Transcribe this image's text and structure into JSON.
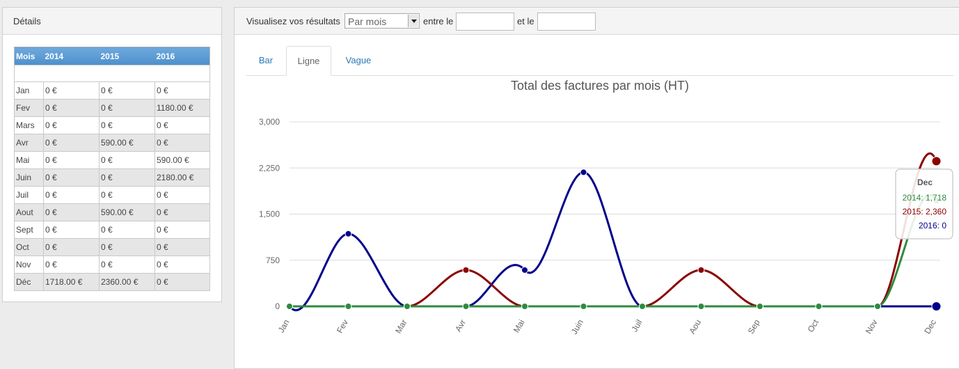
{
  "details": {
    "title": "Détails",
    "headers": [
      "Mois",
      "2014",
      "2015",
      "2016"
    ],
    "rows": [
      [
        "Jan",
        "0 €",
        "0 €",
        "0 €"
      ],
      [
        "Fev",
        "0 €",
        "0 €",
        "1180.00 €"
      ],
      [
        "Mars",
        "0 €",
        "0 €",
        "0 €"
      ],
      [
        "Avr",
        "0 €",
        "590.00 €",
        "0 €"
      ],
      [
        "Mai",
        "0 €",
        "0 €",
        "590.00 €"
      ],
      [
        "Juin",
        "0 €",
        "0 €",
        "2180.00 €"
      ],
      [
        "Juil",
        "0 €",
        "0 €",
        "0 €"
      ],
      [
        "Aout",
        "0 €",
        "590.00 €",
        "0 €"
      ],
      [
        "Sept",
        "0 €",
        "0 €",
        "0 €"
      ],
      [
        "Oct",
        "0 €",
        "0 €",
        "0 €"
      ],
      [
        "Nov",
        "0 €",
        "0 €",
        "0 €"
      ],
      [
        "Déc",
        "1718.00 €",
        "2360.00 €",
        "0 €"
      ]
    ]
  },
  "filter": {
    "label": "Visualisez vos résultats",
    "period_value": "Par mois",
    "between_label": "entre le",
    "and_label": "et le",
    "date_from": "",
    "date_to": ""
  },
  "tabs": [
    {
      "label": "Bar",
      "active": false
    },
    {
      "label": "Ligne",
      "active": true
    },
    {
      "label": "Vague",
      "active": false
    }
  ],
  "chart_data": {
    "type": "line",
    "title": "Total des factures par mois (HT)",
    "xlabel": "",
    "ylabel": "",
    "categories": [
      "Jan",
      "Fev",
      "Mar",
      "Avr",
      "Mai",
      "Juin",
      "Juil",
      "Aou",
      "Sep",
      "Oct",
      "Nov",
      "Dec"
    ],
    "y_ticks": [
      0,
      750,
      1500,
      2250,
      3000
    ],
    "y_tick_labels": [
      "0",
      "750",
      "1,500",
      "2,250",
      "3,000"
    ],
    "ylim": [
      0,
      3000
    ],
    "grid": true,
    "smooth": true,
    "series": [
      {
        "name": "2014",
        "color": "#2e8b3e",
        "values": [
          0,
          0,
          0,
          0,
          0,
          0,
          0,
          0,
          0,
          0,
          0,
          1718
        ]
      },
      {
        "name": "2015",
        "color": "#8b0000",
        "values": [
          0,
          0,
          0,
          590,
          0,
          0,
          0,
          590,
          0,
          0,
          0,
          2360
        ]
      },
      {
        "name": "2016",
        "color": "#00008b",
        "values": [
          0,
          1180,
          0,
          0,
          590,
          2180,
          0,
          0,
          0,
          0,
          0,
          0
        ]
      }
    ],
    "tooltip": {
      "category": "Dec",
      "lines": [
        "2014: 1,718",
        "2015: 2,360",
        "2016: 0"
      ]
    }
  }
}
